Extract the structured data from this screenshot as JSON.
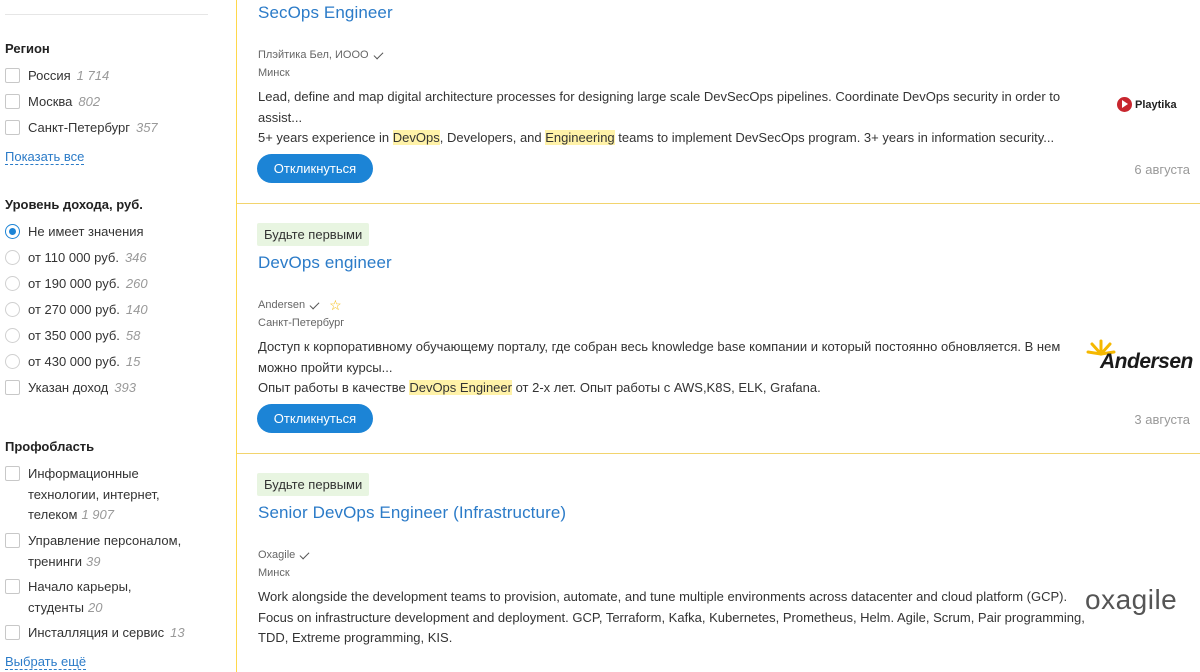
{
  "sidebar": {
    "region": {
      "title": "Регион",
      "options": [
        {
          "label": "Россия",
          "count": "1 714"
        },
        {
          "label": "Москва",
          "count": "802"
        },
        {
          "label": "Санкт-Петербург",
          "count": "357"
        }
      ],
      "show_all": "Показать все"
    },
    "income": {
      "title": "Уровень дохода, руб.",
      "options": [
        {
          "label": "Не имеет значения",
          "count": "",
          "selected": true
        },
        {
          "label": "от 110 000 руб.",
          "count": "346"
        },
        {
          "label": "от 190 000 руб.",
          "count": "260"
        },
        {
          "label": "от 270 000 руб.",
          "count": "140"
        },
        {
          "label": "от 350 000 руб.",
          "count": "58"
        },
        {
          "label": "от 430 000 руб.",
          "count": "15"
        }
      ],
      "specified": {
        "label": "Указан доход",
        "count": "393"
      }
    },
    "area": {
      "title": "Профобласть",
      "options": [
        {
          "label": "Информационные технологии, интернет, телеком",
          "count": "1 907"
        },
        {
          "label": "Управление персоналом, тренинги",
          "count": "39"
        },
        {
          "label": "Начало карьеры, студенты",
          "count": "20"
        },
        {
          "label": "Инсталляция и сервис",
          "count": "13"
        }
      ],
      "choose_more": "Выбрать ещё"
    }
  },
  "vacancies": [
    {
      "title": "SecOps Engineer",
      "company": "Плэйтика Бел, ИООО",
      "city": "Минск",
      "desc1": "Lead, define and map digital architecture processes for designing large scale DevSecOps pipelines. Coordinate DevOps security in order to assist...",
      "desc2_a": "5+ years experience in ",
      "desc2_hl1": "DevOps",
      "desc2_b": ", Developers, and ",
      "desc2_hl2": "Engineering",
      "desc2_c": " teams to implement DevSecOps program. 3+ years in information security...",
      "button": "Откликнуться",
      "date": "6 августа",
      "logo_text": "Playtika"
    },
    {
      "badge": "Будьте первыми",
      "title": "DevOps engineer",
      "company": "Andersen",
      "city": "Санкт-Петербург",
      "desc1": "Доступ к корпоративному обучающему порталу, где собран весь knowledge base компании и который постоянно обновляется. В нем можно пройти курсы...",
      "desc2_a": "Опыт работы в качестве ",
      "desc2_hl1": "DevOps",
      "desc2_b": " ",
      "desc2_hl2": "Engineer",
      "desc2_c": " от 2-х лет. Опыт работы с AWS,K8S, ELK, Grafana.",
      "button": "Откликнуться",
      "date": "3 августа",
      "logo_text": "Andersen"
    },
    {
      "badge": "Будьте первыми",
      "title": "Senior DevOps Engineer (Infrastructure)",
      "company": "Oxagile",
      "city": "Минск",
      "desc1": "Work alongside the development teams to provision, automate, and tune multiple environments across datacenter and cloud platform (GCP).",
      "desc2": "Focus on infrastructure development and deployment. GCP, Terraform, Kafka, Kubernetes, Prometheus, Helm. Agile, Scrum, Pair programming, TDD, Extreme programming, KIS.",
      "logo_text": "oxagile"
    }
  ],
  "colors": {
    "link": "#2b7bc8",
    "button": "#1c84d6",
    "highlight": "#fff2a8",
    "badge_bg": "#e8f5e1",
    "separator": "#f2d46e"
  }
}
